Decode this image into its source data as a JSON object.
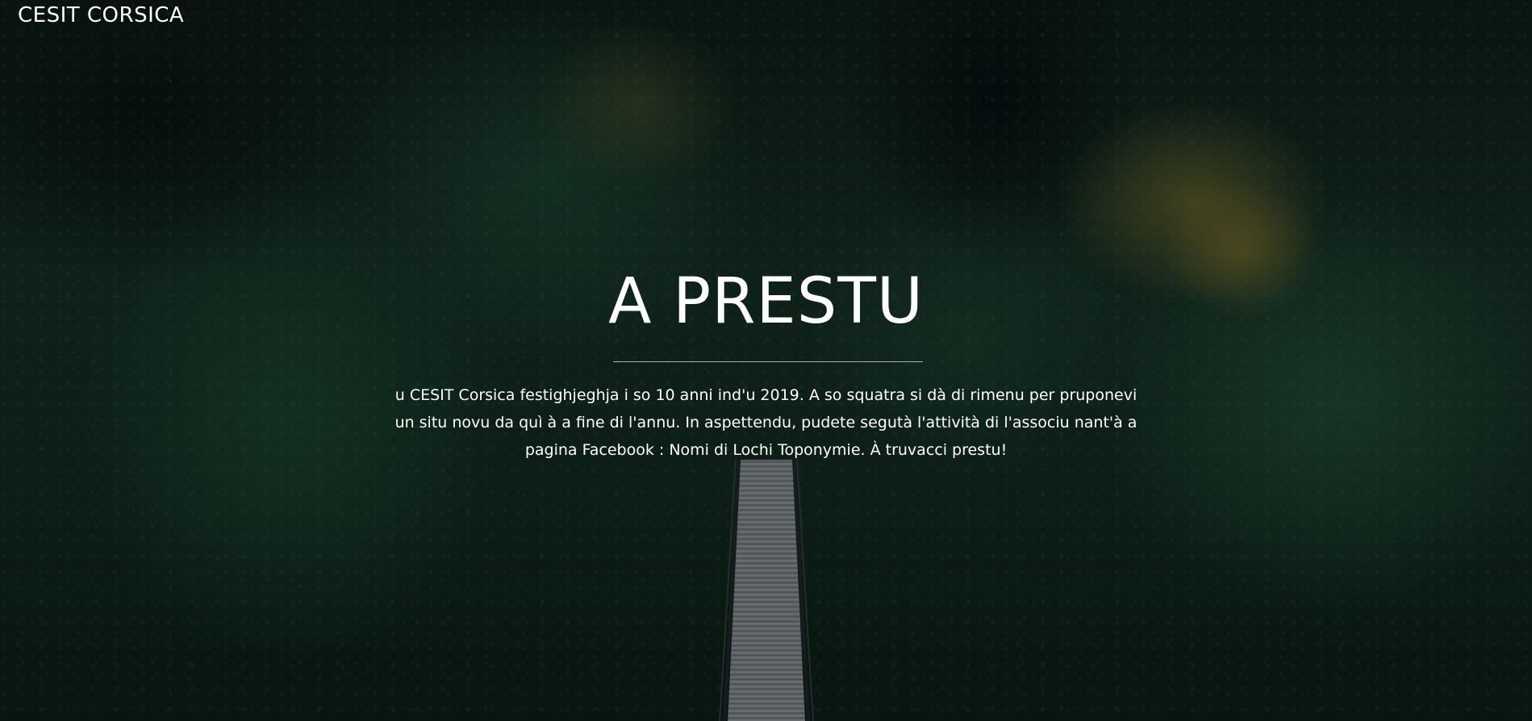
{
  "header": {
    "brand": "CESIT CORSICA"
  },
  "hero": {
    "title": "A PRESTU",
    "text": "u CESIT Corsica festighjeghja i so 10 anni ind'u 2019. A so squatra si dà di rimenu per pruponevi un situ novu da quì à a fine di l'annu. In aspettendu, pudete segutà l'attività di l'associu nant'à a pagina Facebook : Nomi di Lochi Toponymie. À truvacci prestu!"
  }
}
